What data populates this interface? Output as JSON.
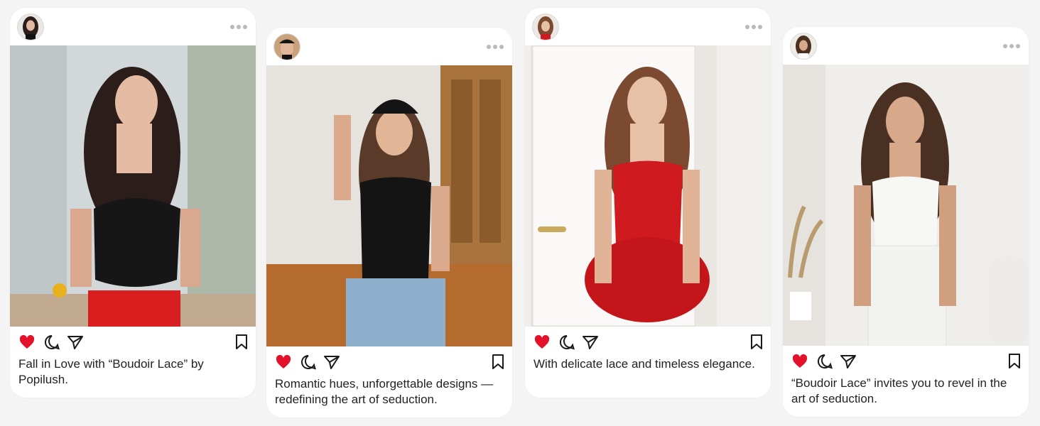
{
  "posts": [
    {
      "caption": "Fall in Love with “Boudoir Lace” by Popilush.",
      "outfit_color": "#1a1a1a",
      "skirt_color": "#d81e1e",
      "background_color": "#cdd4d6"
    },
    {
      "caption": "Romantic hues, unforgettable designs — redefining the art of seduction.",
      "outfit_color": "#141414",
      "skirt_color": "#8fb0cc",
      "background_color": "#e8e4df"
    },
    {
      "caption": "With delicate lace and timeless elegance.",
      "outfit_color": "#cf1b1f",
      "skirt_color": "#c4151b",
      "background_color": "#f0eeeb"
    },
    {
      "caption": "“Boudoir Lace” invites you to revel in the art of seduction.",
      "outfit_color": "#f7f7f5",
      "skirt_color": "#f2f2f0",
      "background_color": "#efeeeb"
    }
  ],
  "icons": {
    "like": "heart-icon",
    "comment": "comment-icon",
    "share": "send-icon",
    "save": "bookmark-icon",
    "more": "more-options-icon"
  },
  "colors": {
    "like_red": "#e3112a",
    "icon_dark": "#1a1a1a",
    "card_bg": "#ffffff",
    "page_bg": "#f4f4f4"
  }
}
